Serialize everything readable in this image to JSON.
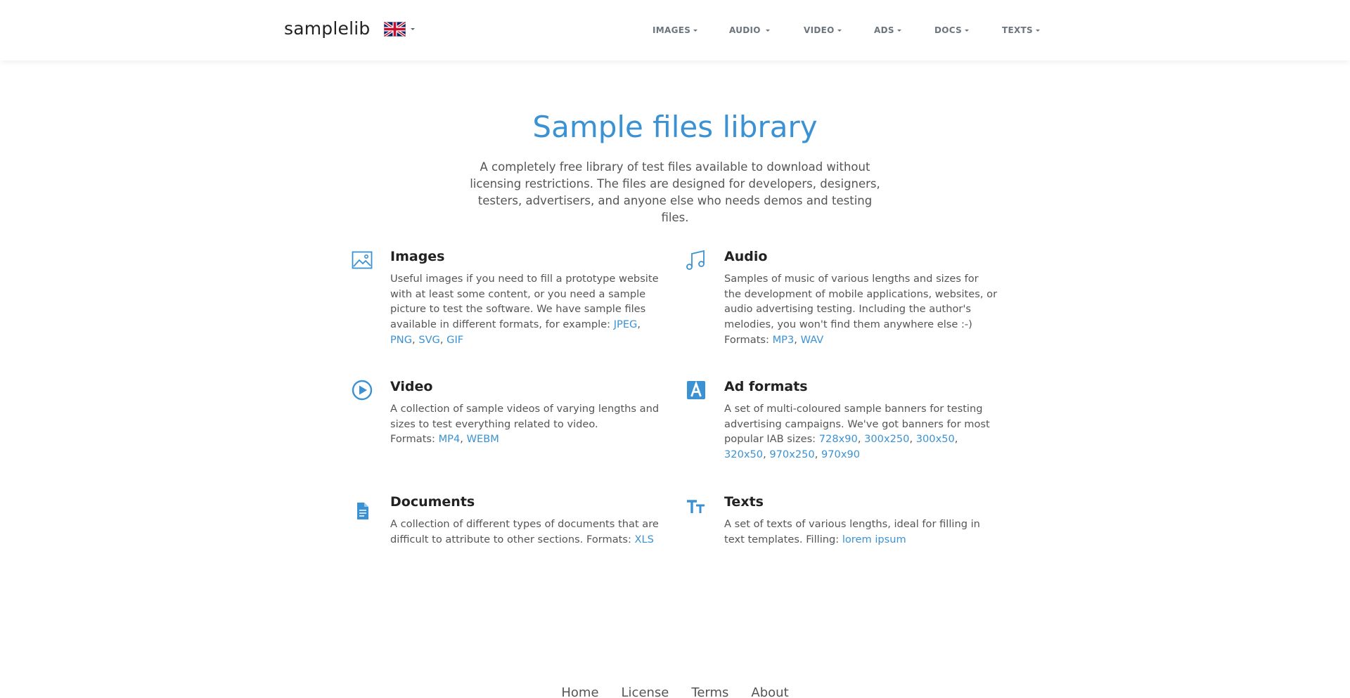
{
  "header": {
    "brand": "samplelib",
    "nav": [
      {
        "label": "IMAGES"
      },
      {
        "label": "AUDIO"
      },
      {
        "label": "VIDEO"
      },
      {
        "label": "ADS"
      },
      {
        "label": "DOCS"
      },
      {
        "label": "TEXTS"
      }
    ]
  },
  "hero": {
    "title": "Sample files library",
    "subtitle": "A completely free library of test files available to download without licensing restrictions. The files are designed for developers, designers, testers, advertisers, and anyone else who needs demos and testing files."
  },
  "features": {
    "images": {
      "icon": "image-icon",
      "title": "Images",
      "text": "Useful images if you need to fill a prototype website with at least some content, or you need a sample picture to test the software. We have sample files available in different formats, for example: ",
      "links": [
        "JPEG",
        "PNG",
        "SVG",
        "GIF"
      ]
    },
    "audio": {
      "icon": "music-note-icon",
      "title": "Audio",
      "text": "Samples of music of various lengths and sizes for the development of mobile applications, websites, or audio advertising testing. Including the author's melodies, you won't find them anywhere else :-)",
      "formats_label": "Formats: ",
      "links": [
        "MP3",
        "WAV"
      ]
    },
    "video": {
      "icon": "play-circle-icon",
      "title": "Video",
      "text": "A collection of sample videos of varying lengths and sizes to test everything related to video.",
      "formats_label": "Formats: ",
      "links": [
        "MP4",
        "WEBM"
      ]
    },
    "ads": {
      "icon": "ad-icon",
      "title": "Ad formats",
      "text": "A set of multi-coloured sample banners for testing advertising campaigns. We've got banners for most popular IAB sizes: ",
      "links": [
        "728x90",
        "300x250",
        "300x50",
        "320x50",
        "970x250",
        "970x90"
      ]
    },
    "docs": {
      "icon": "document-icon",
      "title": "Documents",
      "text": "A collection of different types of documents that are difficult to attribute to other sections. Formats: ",
      "links": [
        "XLS"
      ]
    },
    "texts": {
      "icon": "text-size-icon",
      "title": "Texts",
      "text": "A set of texts of various lengths, ideal for filling in text templates. Filling: ",
      "links": [
        "lorem ipsum"
      ]
    }
  },
  "footer": {
    "links": [
      "Home",
      "License",
      "Terms",
      "About"
    ]
  },
  "colors": {
    "accent": "#3a92d4",
    "heading": "#222222",
    "body_text": "#555555",
    "nav_text": "#6c757d"
  }
}
